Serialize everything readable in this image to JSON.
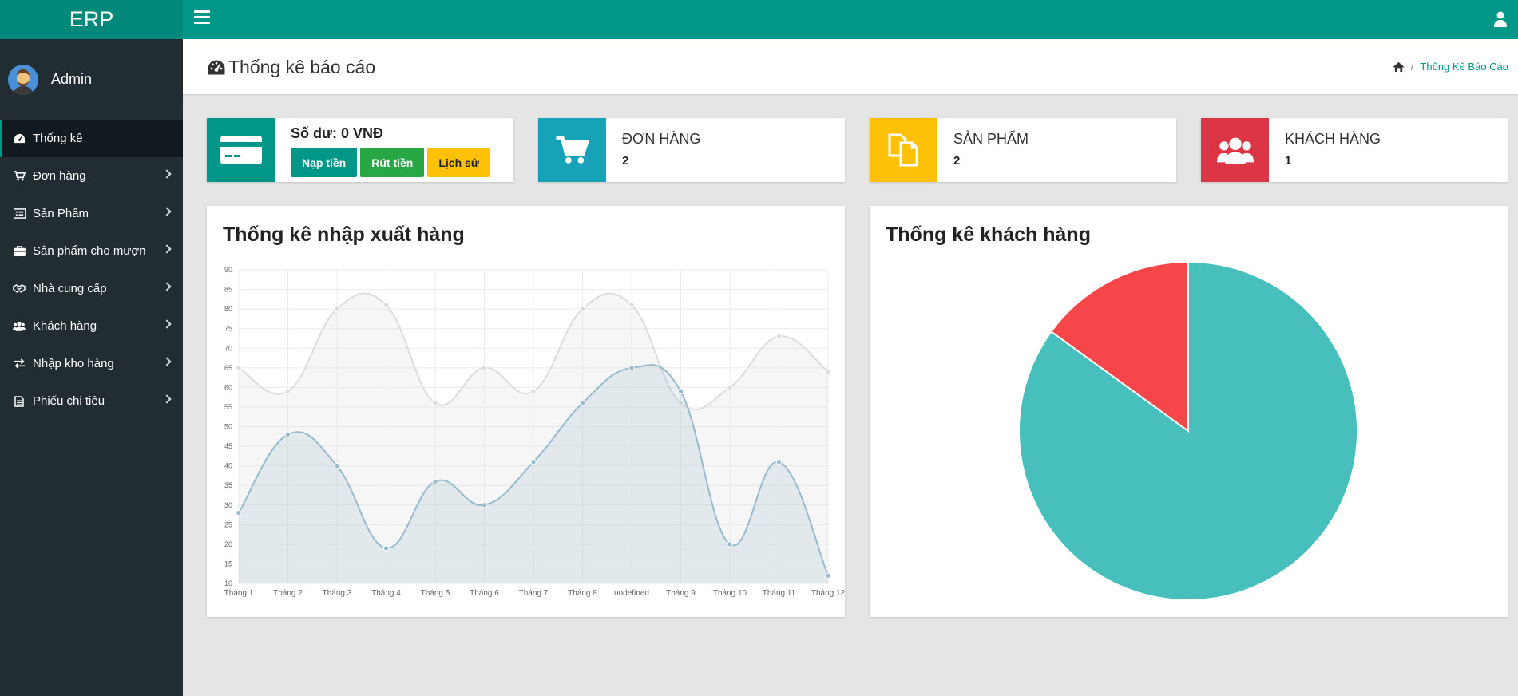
{
  "app": {
    "brand": "ERP"
  },
  "user": {
    "name": "Admin"
  },
  "sidebar": {
    "items": [
      {
        "label": "Thống kê",
        "icon": "dashboard-icon",
        "active": true
      },
      {
        "label": "Đơn hàng",
        "icon": "cart-icon"
      },
      {
        "label": "Sản Phẩm",
        "icon": "list-icon"
      },
      {
        "label": "Sản phẩm cho mượn",
        "icon": "briefcase-icon"
      },
      {
        "label": "Nhà cung cấp",
        "icon": "handshake-icon"
      },
      {
        "label": "Khách hàng",
        "icon": "users-icon"
      },
      {
        "label": "Nhập kho hàng",
        "icon": "exchange-icon"
      },
      {
        "label": "Phiếu chi tiêu",
        "icon": "file-icon"
      }
    ]
  },
  "page": {
    "title": "Thống kê báo cáo",
    "breadcrumb": {
      "sep": "/",
      "current": "Thống Kê Báo Cáo"
    }
  },
  "cards": {
    "balance": {
      "label": "Số dư: 0 VNĐ",
      "deposit": "Nạp tiền",
      "withdraw": "Rút tiền",
      "history": "Lịch sử"
    },
    "orders": {
      "label": "ĐƠN HÀNG",
      "value": "2"
    },
    "products": {
      "label": "SẢN PHẨM",
      "value": "2"
    },
    "customers": {
      "label": "KHÁCH HÀNG",
      "value": "1"
    }
  },
  "colors": {
    "primary": "#009688",
    "brand": "#00897b",
    "sidebar": "#222d32",
    "teal_card": "#009688",
    "cyan_card": "#17a2b8",
    "yellow_card": "#ffc107",
    "red_card": "#dc3545",
    "btn_green": "#28a745",
    "btn_yellow": "#ffc107",
    "series_a": "#dcdcdc",
    "series_b": "#97bbcd",
    "pie_a": "#46bfbd",
    "pie_b": "#f7464a"
  },
  "panels": {
    "line_title": "Thống kê nhập xuất hàng",
    "pie_title": "Thống kê khách hàng"
  },
  "chart_data": [
    {
      "type": "line",
      "title": "Thống kê nhập xuất hàng",
      "categories": [
        "Tháng 1",
        "Tháng 2",
        "Tháng 3",
        "Tháng 4",
        "Tháng 5",
        "Tháng 6",
        "Tháng 7",
        "Tháng 8",
        "undefined",
        "Tháng 9",
        "Tháng 10",
        "Tháng 11",
        "Tháng 12"
      ],
      "series": [
        {
          "values": [
            65,
            59,
            80,
            81,
            56,
            65,
            59,
            80,
            81,
            56,
            60,
            73,
            64
          ]
        },
        {
          "values": [
            28,
            48,
            40,
            19,
            36,
            30,
            41,
            56,
            65,
            59,
            20,
            41,
            12
          ]
        }
      ],
      "ylim": [
        10,
        90
      ],
      "yticks": [
        10,
        15,
        20,
        25,
        30,
        35,
        40,
        45,
        50,
        55,
        60,
        65,
        70,
        75,
        80,
        85,
        90
      ],
      "grid": true
    },
    {
      "type": "pie",
      "title": "Thống kê khách hàng",
      "values": [
        85,
        15
      ]
    }
  ]
}
